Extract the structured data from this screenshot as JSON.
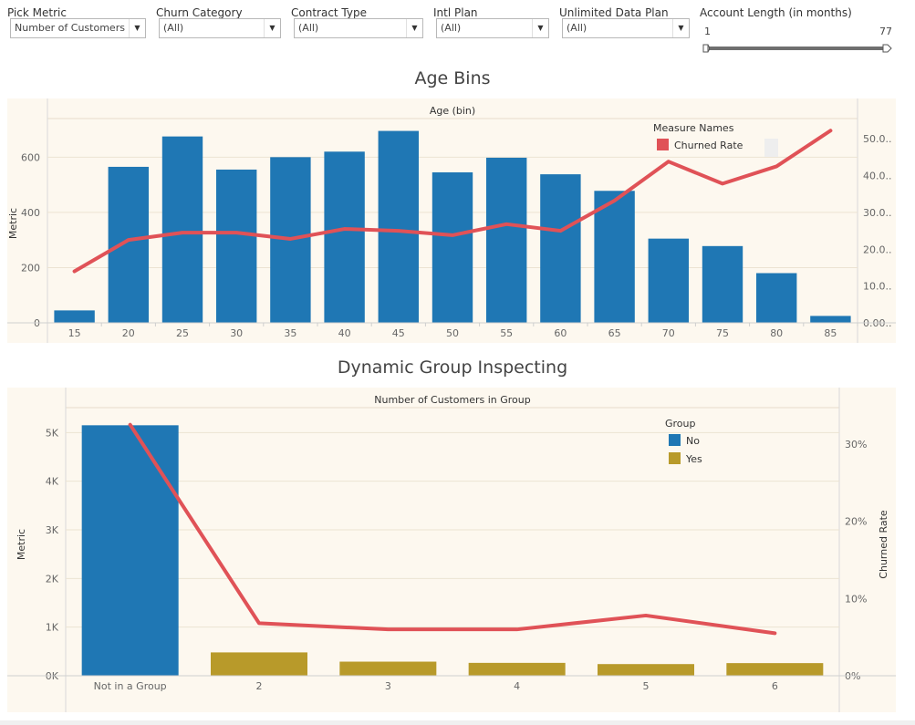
{
  "filters": [
    {
      "label": "Pick Metric",
      "value": "Number of Customers"
    },
    {
      "label": "Churn Category",
      "value": "(All)"
    },
    {
      "label": "Contract Type",
      "value": "(All)"
    },
    {
      "label": "Intl Plan",
      "value": "(All)"
    },
    {
      "label": "Unlimited Data Plan",
      "value": "(All)"
    }
  ],
  "slider": {
    "label": "Account Length (in months)",
    "min": "1",
    "max": "77",
    "selected_min": 1,
    "selected_max": 77
  },
  "colors": {
    "bar_blue": "#1f77b4",
    "bar_gold": "#b89a2a",
    "line_red": "#e05257",
    "panel_bg": "#fdf8ef"
  },
  "chart_data": [
    {
      "type": "bar",
      "title": "Age Bins",
      "header": "Age (bin)",
      "xlabel": "",
      "ylabel": "Metric",
      "categories": [
        "15",
        "20",
        "25",
        "30",
        "35",
        "40",
        "45",
        "50",
        "55",
        "60",
        "65",
        "70",
        "75",
        "80",
        "85"
      ],
      "ylim": [
        0,
        720
      ],
      "yticks": [
        "0",
        "200",
        "400",
        "600"
      ],
      "y2lim": [
        0,
        54
      ],
      "y2ticks": [
        "0.00..",
        "10.0..",
        "20.0..",
        "30.0..",
        "40.0..",
        "50.0.."
      ],
      "series": [
        {
          "name": "Metric",
          "kind": "bar",
          "values": [
            45,
            565,
            675,
            555,
            600,
            620,
            695,
            545,
            598,
            538,
            478,
            305,
            278,
            180,
            25
          ]
        },
        {
          "name": "Churned Rate",
          "kind": "line",
          "axis": "right",
          "values": [
            14,
            22.5,
            24.5,
            24.5,
            22.8,
            25.5,
            25,
            23.8,
            26.8,
            25,
            33.2,
            43.8,
            37.8,
            42.5,
            52.2
          ]
        }
      ],
      "legend": {
        "title": "Measure Names",
        "items": [
          {
            "label": "Churned Rate",
            "color": "#e05257"
          }
        ],
        "placement": "top-right"
      },
      "grid": true
    },
    {
      "type": "bar",
      "title": "Dynamic Group Inspecting",
      "header": "Number of Customers in Group",
      "xlabel": "",
      "ylabel": "Metric",
      "y2label": "Churned Rate",
      "categories": [
        "Not in a Group",
        "2",
        "3",
        "4",
        "5",
        "6"
      ],
      "ylim": [
        0,
        5400
      ],
      "yticks": [
        "0K",
        "1K",
        "2K",
        "3K",
        "4K",
        "5K"
      ],
      "y2lim": [
        0,
        34
      ],
      "y2ticks": [
        "0%",
        "10%",
        "20%",
        "30%"
      ],
      "series": [
        {
          "name": "Metric",
          "kind": "bar",
          "values": [
            5150,
            480,
            290,
            265,
            240,
            260
          ],
          "group": [
            "No",
            "Yes",
            "Yes",
            "Yes",
            "Yes",
            "Yes"
          ]
        },
        {
          "name": "Churned Rate",
          "kind": "line",
          "axis": "right",
          "values": [
            32.5,
            6.8,
            6.0,
            6.0,
            7.8,
            5.5
          ]
        }
      ],
      "legend": {
        "title": "Group",
        "items": [
          {
            "label": "No",
            "color": "#1f77b4"
          },
          {
            "label": "Yes",
            "color": "#b89a2a"
          }
        ],
        "placement": "top-right"
      },
      "grid": true
    }
  ]
}
